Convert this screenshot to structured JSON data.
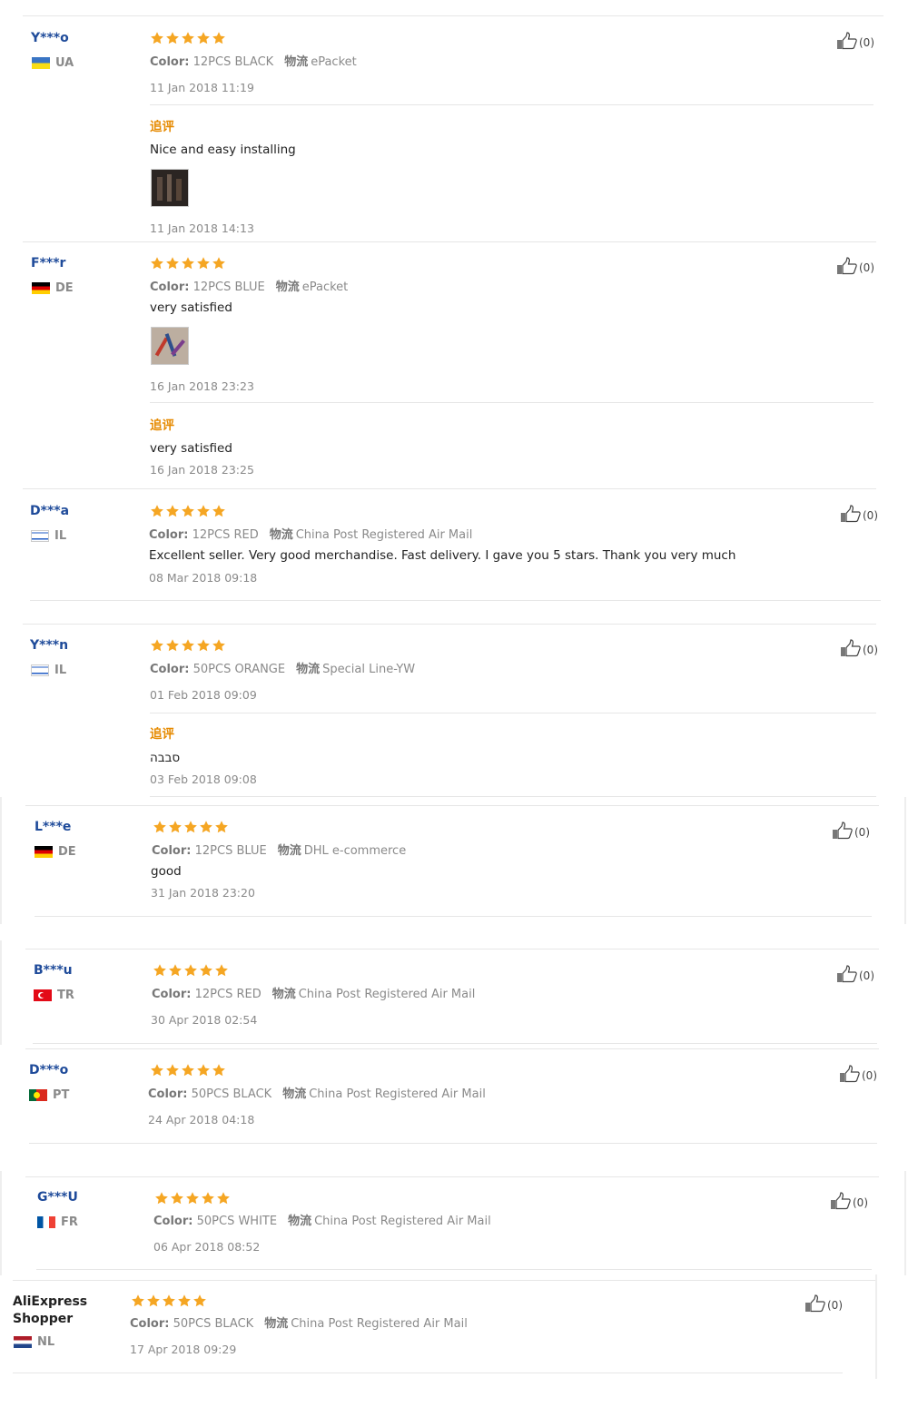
{
  "labels": {
    "color": "Color:",
    "logistics": "物流",
    "followup": "追评",
    "like": "(0)"
  },
  "colors": {
    "star": "#f5a623",
    "username": "#1f4b9a",
    "followup": "#e68a00"
  },
  "reviews": [
    {
      "user": "Y***o",
      "country": "UA",
      "color_value": "12PCS BLACK",
      "shipping": "ePacket",
      "date": "11 Jan 2018 11:19",
      "text": "",
      "followup_text": "Nice and easy installing",
      "followup_date": "11 Jan 2018 14:13"
    },
    {
      "user": "F***r",
      "country": "DE",
      "color_value": "12PCS BLUE",
      "shipping": "ePacket",
      "text": "very satisfied",
      "date": "16 Jan 2018 23:23",
      "followup_text": "very satisfied",
      "followup_date": "16 Jan 2018 23:25"
    },
    {
      "user": "D***a",
      "country": "IL",
      "color_value": "12PCS RED",
      "shipping": "China Post Registered Air Mail",
      "text": "Excellent seller. Very good merchandise. Fast delivery. I gave you 5 stars. Thank you very much",
      "date": "08 Mar 2018 09:18"
    },
    {
      "user": "Y***n",
      "country": "IL",
      "color_value": "50PCS ORANGE",
      "shipping": "Special Line-YW",
      "date": "01 Feb 2018 09:09",
      "followup_text": "סבבה",
      "followup_date": "03 Feb 2018 09:08"
    },
    {
      "user": "L***e",
      "country": "DE",
      "color_value": "12PCS BLUE",
      "shipping": "DHL e-commerce",
      "text": "good",
      "date": "31 Jan 2018 23:20"
    },
    {
      "user": "B***u",
      "country": "TR",
      "color_value": "12PCS RED",
      "shipping": "China Post Registered Air Mail",
      "date": "30 Apr 2018 02:54"
    },
    {
      "user": "D***o",
      "country": "PT",
      "color_value": "50PCS BLACK",
      "shipping": "China Post Registered Air Mail",
      "date": "24 Apr 2018 04:18"
    },
    {
      "user": "G***U",
      "country": "FR",
      "color_value": "50PCS WHITE",
      "shipping": "China Post Registered Air Mail",
      "date": "06 Apr 2018 08:52"
    },
    {
      "user_line1": "AliExpress",
      "user_line2": "Shopper",
      "country": "NL",
      "color_value": "50PCS BLACK",
      "shipping": "China Post Registered Air Mail",
      "date": "17 Apr 2018 09:29"
    }
  ]
}
